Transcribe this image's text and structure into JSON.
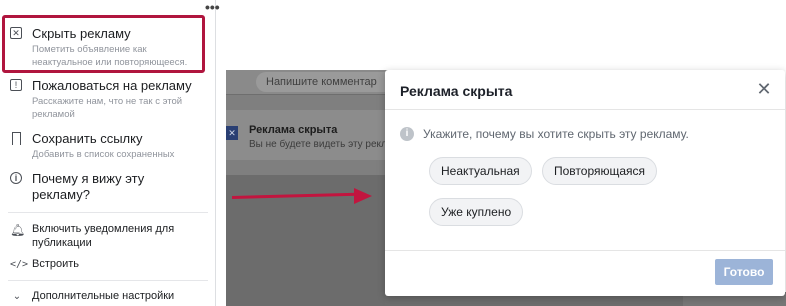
{
  "menu": {
    "more_icon": "more-dots-icon",
    "items": [
      {
        "icon": "close-box-icon",
        "title": "Скрыть рекламу",
        "subtitle": "Пометить объявление как неактуальное или повторяющееся."
      },
      {
        "icon": "report-icon",
        "title": "Пожаловаться на рекламу",
        "subtitle": "Расскажите нам, что не так с этой рекламой"
      },
      {
        "icon": "bookmark-icon",
        "title": "Сохранить ссылку",
        "subtitle": "Добавить в список сохраненных"
      },
      {
        "icon": "info-icon",
        "title": "Почему я вижу эту рекламу?",
        "subtitle": ""
      },
      {
        "icon": "bell-icon",
        "title": "Включить уведомления для публикации",
        "subtitle": ""
      },
      {
        "icon": "code-icon",
        "title": "Встроить",
        "subtitle": ""
      },
      {
        "icon": "chevron-down-icon",
        "title": "Дополнительные настройки",
        "subtitle": ""
      }
    ]
  },
  "feed": {
    "comment_placeholder": "Напишите комментар",
    "hidden_title": "Реклама скрыта",
    "hidden_subtitle": "Вы не будете видеть эту рекламу"
  },
  "dialog": {
    "title": "Реклама скрыта",
    "close_icon": "close-icon",
    "info_icon": "info-icon",
    "prompt": "Укажите, почему вы хотите скрыть эту рекламу.",
    "options": [
      "Неактуальная",
      "Повторяющаяся",
      "Уже куплено"
    ],
    "done_label": "Готово"
  },
  "colors": {
    "highlight": "#b0153e",
    "arrow": "#c2153f",
    "done_button": "#9cb4d8",
    "brand_blue": "#2a3f73"
  }
}
